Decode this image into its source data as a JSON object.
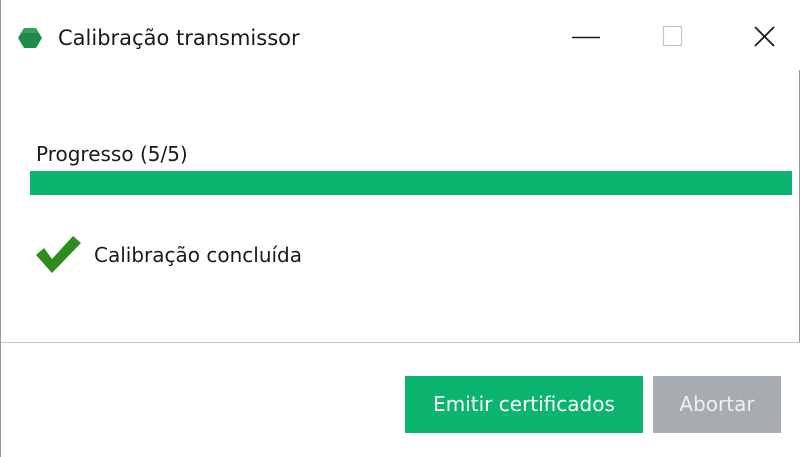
{
  "window": {
    "title": "Calibração transmissor",
    "icon": "green-hexagon-icon",
    "controls": {
      "minimize": "minimize-icon",
      "maximize": "maximize-icon",
      "close": "close-icon"
    }
  },
  "progress": {
    "label": "Progresso (5/5)",
    "current": 5,
    "total": 5,
    "fraction": 1.0,
    "color": "#0cb56f"
  },
  "status": {
    "icon": "checkmark-icon",
    "text": "Calibração concluída",
    "icon_color": "#2e8b1e"
  },
  "footer": {
    "primary_button_label": "Emitir certificados",
    "abort_button_label": "Abortar",
    "primary_color": "#0cb56f",
    "disabled_color": "#a7acb1"
  }
}
